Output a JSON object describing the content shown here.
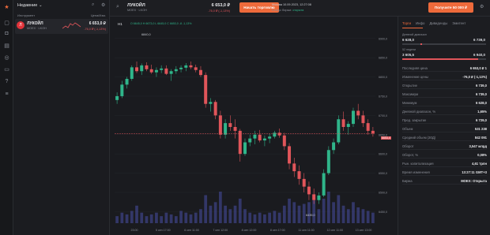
{
  "colors": {
    "accent": "#ee6a3b",
    "up": "#2fb58a",
    "down": "#e0555a",
    "bg": "#1a1b1f"
  },
  "rail_icons": [
    "logo-icon",
    "bell-icon",
    "briefcase-icon",
    "chart-icon",
    "globe-icon",
    "message-icon",
    "help-icon",
    "menu-icon"
  ],
  "watchlist": {
    "title": "Недавние",
    "col_instrument": "Инструмент",
    "col_price": "Цена/Изм.",
    "item": {
      "name": "ЛУКОЙЛ",
      "sub": "MOEX · LKOH",
      "price": "6 653,0 ₽",
      "change": "-76,0 ₽ (-1,13%)"
    }
  },
  "header": {
    "name": "ЛУКОЙЛ",
    "sub": "MOEX · LKOH",
    "price": "6 653,0 ₽",
    "change": "-76,0 ₽ (-1,13%)",
    "start_trading": "Начать торговлю",
    "time": "Москва 10.09.2023, 12:27:08",
    "status_label": "Статус биржи:",
    "status_value": "открыта",
    "deposit": "Получите 50 000 ₽"
  },
  "chart": {
    "timeframe": "H1",
    "ohlc": "O 6645,0  H 6673,0  L 6645,0  C 6653,0  -8  -1,13%",
    "hi_label": "6840,0",
    "lo_label": "6435,0",
    "last_price": "6653,0",
    "y_ticks": [
      "6900,0",
      "6850,0",
      "6800,0",
      "6750,0",
      "6700,0",
      "6650,0",
      "6600,0",
      "6550,0",
      "6500,0",
      "6450,0"
    ],
    "x_ticks": [
      "23:00",
      "5 сен 17:00",
      "6 сен 11:00",
      "7 сен 12:00",
      "8 сен 12:00",
      "8 сен 17:00",
      "11 сен 11:00",
      "12 сен 11:00",
      "13 сен 13:00"
    ]
  },
  "chart_data": {
    "type": "candlestick",
    "ylim": [
      6420,
      6920
    ],
    "candles": [
      [
        6740,
        6760,
        6730,
        6750
      ],
      [
        6750,
        6790,
        6745,
        6780
      ],
      [
        6780,
        6800,
        6770,
        6795
      ],
      [
        6795,
        6830,
        6790,
        6825
      ],
      [
        6825,
        6840,
        6810,
        6815
      ],
      [
        6815,
        6835,
        6805,
        6830
      ],
      [
        6830,
        6838,
        6815,
        6820
      ],
      [
        6820,
        6832,
        6808,
        6812
      ],
      [
        6812,
        6825,
        6800,
        6818
      ],
      [
        6818,
        6830,
        6810,
        6822
      ],
      [
        6822,
        6830,
        6805,
        6808
      ],
      [
        6808,
        6820,
        6790,
        6815
      ],
      [
        6815,
        6828,
        6808,
        6820
      ],
      [
        6820,
        6830,
        6812,
        6824
      ],
      [
        6824,
        6836,
        6815,
        6830
      ],
      [
        6830,
        6840,
        6820,
        6825
      ],
      [
        6825,
        6832,
        6812,
        6818
      ],
      [
        6818,
        6828,
        6800,
        6805
      ],
      [
        6805,
        6812,
        6720,
        6730
      ],
      [
        6730,
        6745,
        6710,
        6735
      ],
      [
        6735,
        6740,
        6690,
        6700
      ],
      [
        6700,
        6712,
        6640,
        6650
      ],
      [
        6650,
        6690,
        6640,
        6680
      ],
      [
        6680,
        6700,
        6660,
        6670
      ],
      [
        6670,
        6690,
        6640,
        6660
      ],
      [
        6660,
        6665,
        6580,
        6600
      ],
      [
        6600,
        6640,
        6595,
        6630
      ],
      [
        6630,
        6650,
        6620,
        6640
      ],
      [
        6640,
        6660,
        6625,
        6650
      ],
      [
        6650,
        6662,
        6630,
        6635
      ],
      [
        6635,
        6648,
        6620,
        6640
      ],
      [
        6640,
        6652,
        6628,
        6645
      ],
      [
        6645,
        6660,
        6640,
        6655
      ],
      [
        6655,
        6666,
        6642,
        6648
      ],
      [
        6648,
        6655,
        6610,
        6620
      ],
      [
        6620,
        6628,
        6560,
        6575
      ],
      [
        6575,
        6590,
        6540,
        6555
      ],
      [
        6555,
        6570,
        6520,
        6535
      ],
      [
        6535,
        6550,
        6500,
        6515
      ],
      [
        6515,
        6528,
        6480,
        6495
      ],
      [
        6495,
        6510,
        6470,
        6480
      ],
      [
        6480,
        6500,
        6470,
        6492
      ],
      [
        6492,
        6560,
        6488,
        6550
      ],
      [
        6550,
        6620,
        6545,
        6610
      ],
      [
        6610,
        6640,
        6600,
        6630
      ],
      [
        6630,
        6700,
        6625,
        6690
      ],
      [
        6690,
        6710,
        6660,
        6670
      ],
      [
        6670,
        6685,
        6650,
        6678
      ],
      [
        6678,
        6720,
        6670,
        6712
      ],
      [
        6712,
        6730,
        6690,
        6700
      ],
      [
        6700,
        6712,
        6670,
        6680
      ],
      [
        6680,
        6690,
        6650,
        6660
      ],
      [
        6660,
        6670,
        6645,
        6653
      ]
    ],
    "volumes": [
      0.2,
      0.3,
      0.25,
      0.35,
      0.5,
      0.3,
      0.2,
      0.25,
      0.3,
      0.2,
      0.3,
      0.25,
      0.2,
      0.35,
      0.3,
      0.25,
      0.3,
      0.4,
      0.8,
      0.5,
      0.6,
      0.9,
      0.5,
      0.4,
      0.5,
      0.7,
      0.4,
      0.3,
      0.25,
      0.3,
      0.25,
      0.3,
      0.35,
      0.3,
      0.5,
      0.7,
      0.6,
      0.5,
      0.55,
      0.6,
      0.65,
      0.4,
      0.7,
      0.9,
      0.6,
      0.8,
      0.5,
      0.4,
      0.6,
      0.45,
      0.4,
      0.35,
      0.3
    ]
  },
  "panel": {
    "tabs": [
      "Торги",
      "Инфо",
      "Дивиденды",
      "Эмитент"
    ],
    "day_range_label": "Дневной диапазон",
    "day_low": "6 628,0",
    "day_high": "6 739,0",
    "week_label": "52 недели",
    "week_low": "3 605,5",
    "week_high": "6 940,0",
    "rows": [
      [
        "Последняя цена",
        "6 653,0 ₽ 1"
      ],
      [
        "Изменение цены",
        "-76,0 ₽ (-1,13%)"
      ],
      [
        "Открытие",
        "6 739,0"
      ],
      [
        "Максимум",
        "6 739,0"
      ],
      [
        "Минимум",
        "6 628,0"
      ],
      [
        "Дневной диапазон, %",
        "1,65%"
      ],
      [
        "Пред. закрытие",
        "6 729,0"
      ],
      [
        "Объем",
        "531 238"
      ],
      [
        "Средний объем (30Д)",
        "842 091"
      ],
      [
        "Оборот",
        "3,547 млрд"
      ],
      [
        "Оборот, %",
        "0,08%"
      ],
      [
        "Рын. капитализация",
        "4,61 трлн"
      ],
      [
        "Время изменения",
        "13:27:11 GMT+3"
      ],
      [
        "Биржа",
        "MOEX: Открыта"
      ]
    ]
  }
}
